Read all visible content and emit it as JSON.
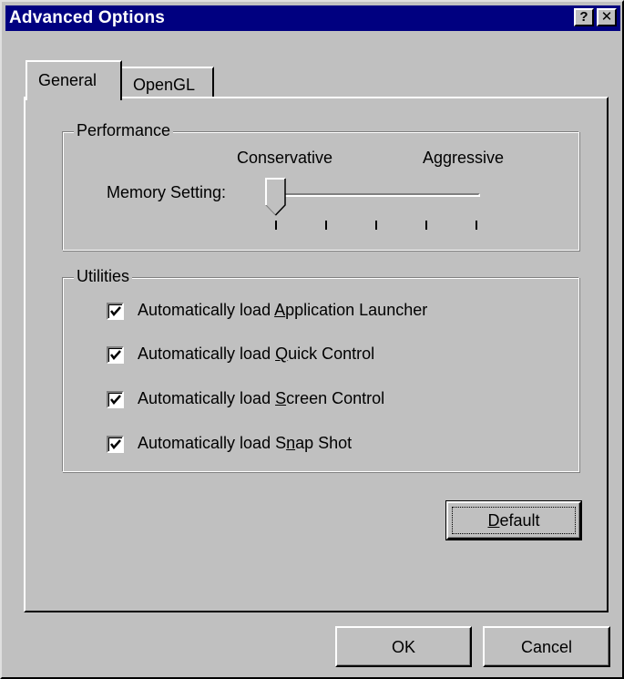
{
  "window": {
    "title": "Advanced Options",
    "help_glyph": "?",
    "close_glyph": "✕"
  },
  "tabs": [
    {
      "label": "General",
      "active": true
    },
    {
      "label": "OpenGL",
      "active": false
    }
  ],
  "performance": {
    "group_label": "Performance",
    "slider_label": "Memory Setting:",
    "min_label": "Conservative",
    "max_label": "Aggressive",
    "tick_count": 5,
    "value_index": 0
  },
  "utilities": {
    "group_label": "Utilities",
    "items": [
      {
        "pre": "Automatically load ",
        "mnemonic": "A",
        "post": "pplication Launcher",
        "checked": true
      },
      {
        "pre": "Automatically load ",
        "mnemonic": "Q",
        "post": "uick Control",
        "checked": true
      },
      {
        "pre": "Automatically load ",
        "mnemonic": "S",
        "post": "creen Control",
        "checked": true
      },
      {
        "pre": "Automatically load S",
        "mnemonic": "n",
        "post": "ap Shot",
        "checked": true
      }
    ]
  },
  "buttons": {
    "default_mnemonic": "D",
    "default_rest": "efault",
    "ok": "OK",
    "cancel": "Cancel"
  },
  "colors": {
    "titlebar": "#000080",
    "face": "#c0c0c0"
  }
}
